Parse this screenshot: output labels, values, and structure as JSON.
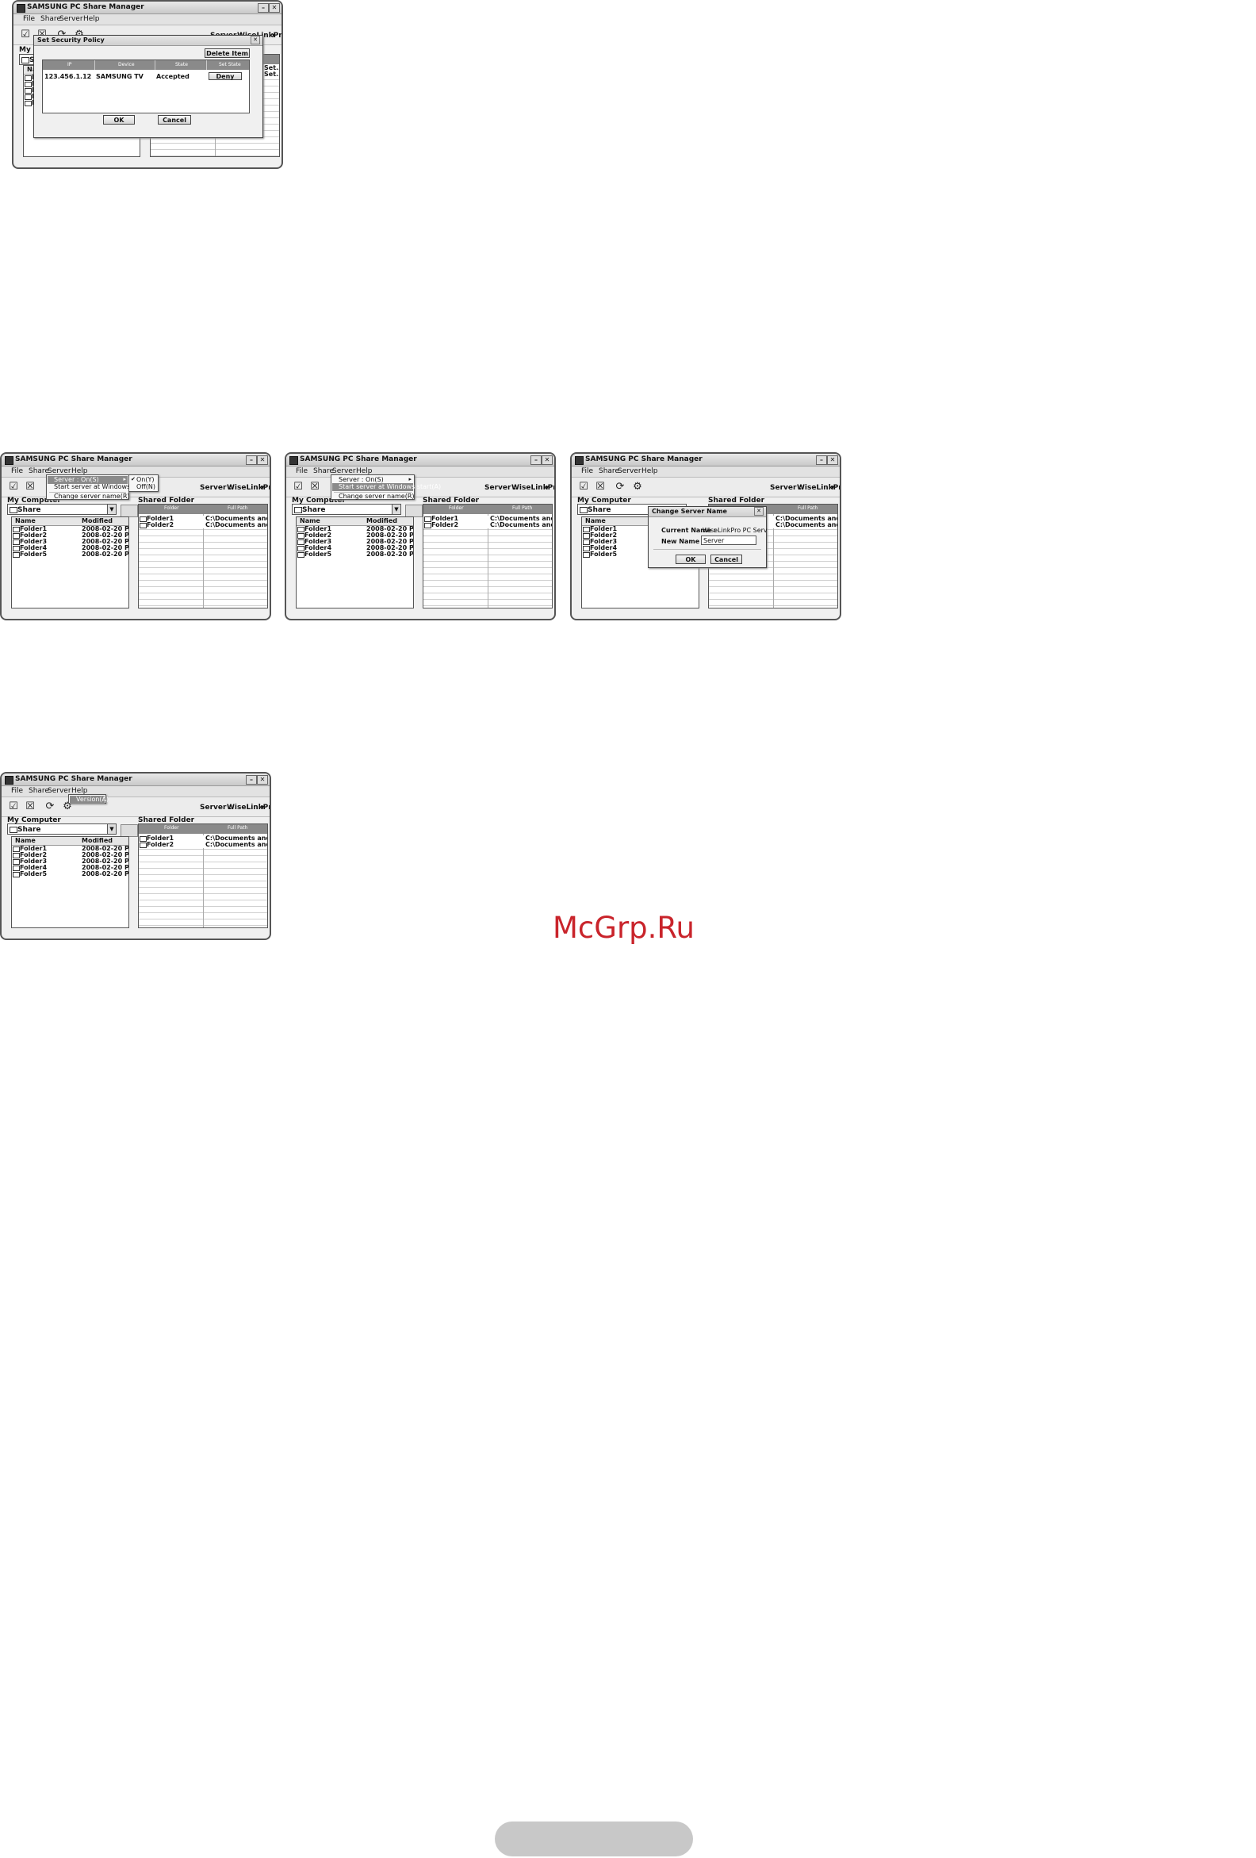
{
  "app": {
    "title": "SAMSUNG PC Share Manager",
    "menu": [
      "File",
      "Share",
      "Server",
      "Help"
    ],
    "server_label": "Server :",
    "server_value": "WiseLinkPro",
    "my_computer_label": "My Computer",
    "shared_folder_label": "Shared Folder",
    "combo_value": "Share",
    "columns": {
      "name": "Name",
      "modified": "Modified",
      "folder": "Folder",
      "full_path": "Full Path"
    },
    "folders": [
      {
        "name": "Folder1",
        "modified": "2008-02-20 P..."
      },
      {
        "name": "Folder2",
        "modified": "2008-02-20 P..."
      },
      {
        "name": "Folder3",
        "modified": "2008-02-20 P..."
      },
      {
        "name": "Folder4",
        "modified": "2008-02-20 P..."
      },
      {
        "name": "Folder5",
        "modified": "2008-02-20 P..."
      }
    ],
    "shared": [
      {
        "folder": "Folder1",
        "path": "C:\\Documents and Set..."
      },
      {
        "folder": "Folder2",
        "path": "C:\\Documents and Set..."
      }
    ]
  },
  "security_dialog": {
    "title": "Set Security Policy",
    "delete_label": "Delete Item",
    "headers": [
      "IP",
      "Device",
      "State",
      "Set State"
    ],
    "row": {
      "ip": "123.456.1.12",
      "device": "SAMSUNG TV",
      "state": "Accepted",
      "action": "Deny"
    },
    "ok": "OK",
    "cancel": "Cancel",
    "bg_my_computer_partial": "My Co",
    "bg_combo_partial": "Sh",
    "bg_name_partial": "Nam",
    "bg_set_partial": "Set..."
  },
  "server_menu": {
    "item_server": "Server : On(S)",
    "item_start": "Start server at Windows start(A)",
    "item_change": "Change server name(R)",
    "sub_on": "On(Y)",
    "sub_off": "Off(N)"
  },
  "rename_dialog": {
    "title": "Change Server Name",
    "current_label": "Current Name :",
    "current_value": "WiseLinkPro PC Serv",
    "new_label": "New Name :",
    "new_value": "Server",
    "ok": "OK",
    "cancel": "Cancel"
  },
  "help_menu": {
    "version": "Version(A)"
  },
  "watermark": "McGrp.Ru"
}
